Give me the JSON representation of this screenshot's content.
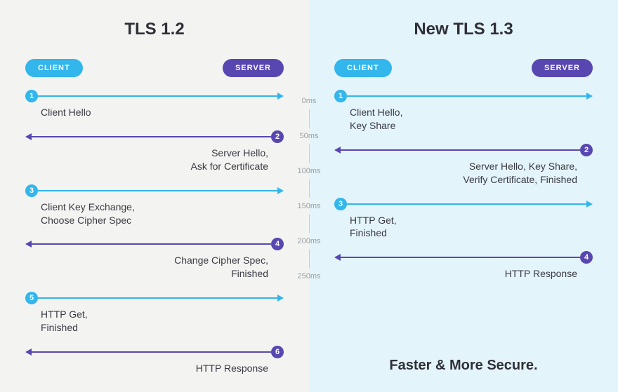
{
  "left": {
    "title": "TLS 1.2",
    "client_badge": "CLIENT",
    "server_badge": "SERVER",
    "steps": [
      {
        "n": "1",
        "dir": "c2s",
        "label": "Client Hello"
      },
      {
        "n": "2",
        "dir": "s2c",
        "label": "Server Hello,\nAsk for Certificate"
      },
      {
        "n": "3",
        "dir": "c2s",
        "label": "Client Key Exchange,\nChoose Cipher Spec"
      },
      {
        "n": "4",
        "dir": "s2c",
        "label": "Change Cipher Spec,\nFinished"
      },
      {
        "n": "5",
        "dir": "c2s",
        "label": "HTTP Get,\nFinished"
      },
      {
        "n": "6",
        "dir": "s2c",
        "label": "HTTP Response"
      }
    ]
  },
  "right": {
    "title": "New TLS 1.3",
    "client_badge": "CLIENT",
    "server_badge": "SERVER",
    "steps": [
      {
        "n": "1",
        "dir": "c2s",
        "label": "Client Hello,\nKey Share"
      },
      {
        "n": "2",
        "dir": "s2c",
        "label": "Server Hello, Key Share,\nVerify Certificate, Finished"
      },
      {
        "n": "3",
        "dir": "c2s",
        "label": "HTTP Get,\nFinished"
      },
      {
        "n": "4",
        "dir": "s2c",
        "label": "HTTP Response"
      }
    ],
    "tagline": "Faster & More Secure."
  },
  "timeline": [
    "0ms",
    "50ms",
    "100ms",
    "150ms",
    "200ms",
    "250ms"
  ],
  "chart_data": {
    "type": "sequence-diagram-comparison",
    "timeline_ms": [
      0,
      50,
      100,
      150,
      200,
      250
    ],
    "protocols": [
      {
        "name": "TLS 1.2",
        "messages": [
          {
            "step": 1,
            "from": "client",
            "to": "server",
            "text": "Client Hello"
          },
          {
            "step": 2,
            "from": "server",
            "to": "client",
            "text": "Server Hello, Ask for Certificate"
          },
          {
            "step": 3,
            "from": "client",
            "to": "server",
            "text": "Client Key Exchange, Choose Cipher Spec"
          },
          {
            "step": 4,
            "from": "server",
            "to": "client",
            "text": "Change Cipher Spec, Finished"
          },
          {
            "step": 5,
            "from": "client",
            "to": "server",
            "text": "HTTP Get, Finished"
          },
          {
            "step": 6,
            "from": "server",
            "to": "client",
            "text": "HTTP Response"
          }
        ]
      },
      {
        "name": "New TLS 1.3",
        "messages": [
          {
            "step": 1,
            "from": "client",
            "to": "server",
            "text": "Client Hello, Key Share"
          },
          {
            "step": 2,
            "from": "server",
            "to": "client",
            "text": "Server Hello, Key Share, Verify Certificate, Finished"
          },
          {
            "step": 3,
            "from": "client",
            "to": "server",
            "text": "HTTP Get, Finished"
          },
          {
            "step": 4,
            "from": "server",
            "to": "client",
            "text": "HTTP Response"
          }
        ],
        "note": "Faster & More Secure."
      }
    ]
  }
}
